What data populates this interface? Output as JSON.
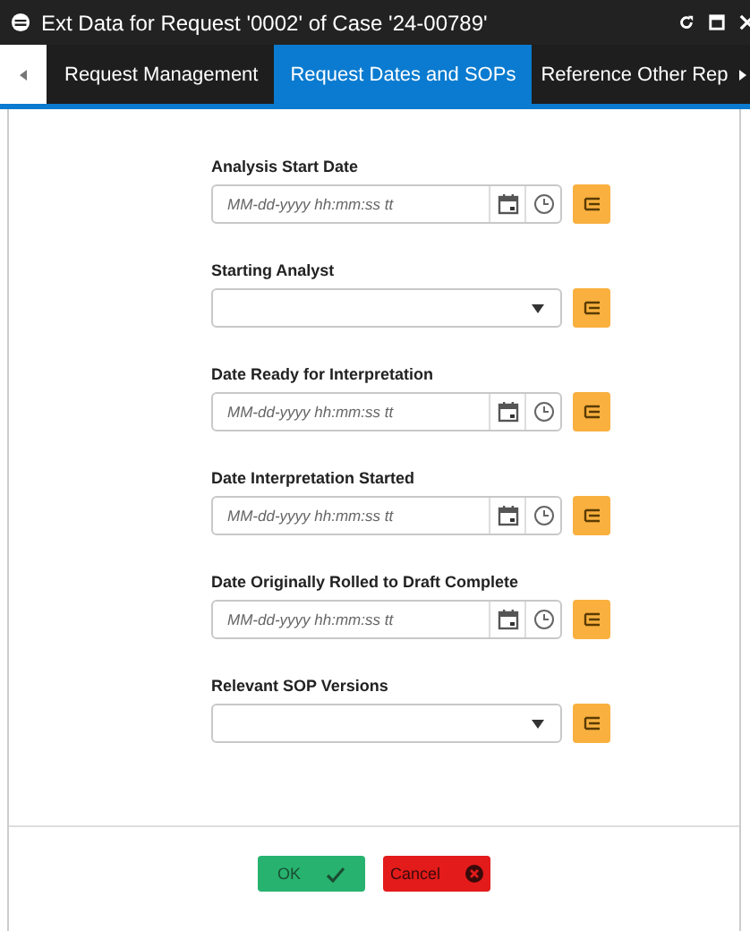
{
  "window": {
    "title": "Ext Data for Request '0002' of Case '24-00789'"
  },
  "tabs": [
    {
      "label": "Request Management",
      "selected": false
    },
    {
      "label": "Request Dates and SOPs",
      "selected": true
    },
    {
      "label": "Reference Other Rep",
      "selected": false
    }
  ],
  "fields": [
    {
      "label": "Analysis Start Date",
      "kind": "datetime",
      "placeholder": "MM-dd-yyyy hh:mm:ss tt"
    },
    {
      "label": "Starting Analyst",
      "kind": "select"
    },
    {
      "label": "Date Ready for Interpretation",
      "kind": "datetime",
      "placeholder": "MM-dd-yyyy hh:mm:ss tt"
    },
    {
      "label": "Date Interpretation Started",
      "kind": "datetime",
      "placeholder": "MM-dd-yyyy hh:mm:ss tt"
    },
    {
      "label": "Date Originally Rolled to Draft Complete",
      "kind": "datetime",
      "placeholder": "MM-dd-yyyy hh:mm:ss tt"
    },
    {
      "label": "Relevant SOP Versions",
      "kind": "select"
    }
  ],
  "buttons": [
    {
      "label": "OK",
      "kind": "ok"
    },
    {
      "label": "Cancel",
      "kind": "cancel"
    }
  ]
}
